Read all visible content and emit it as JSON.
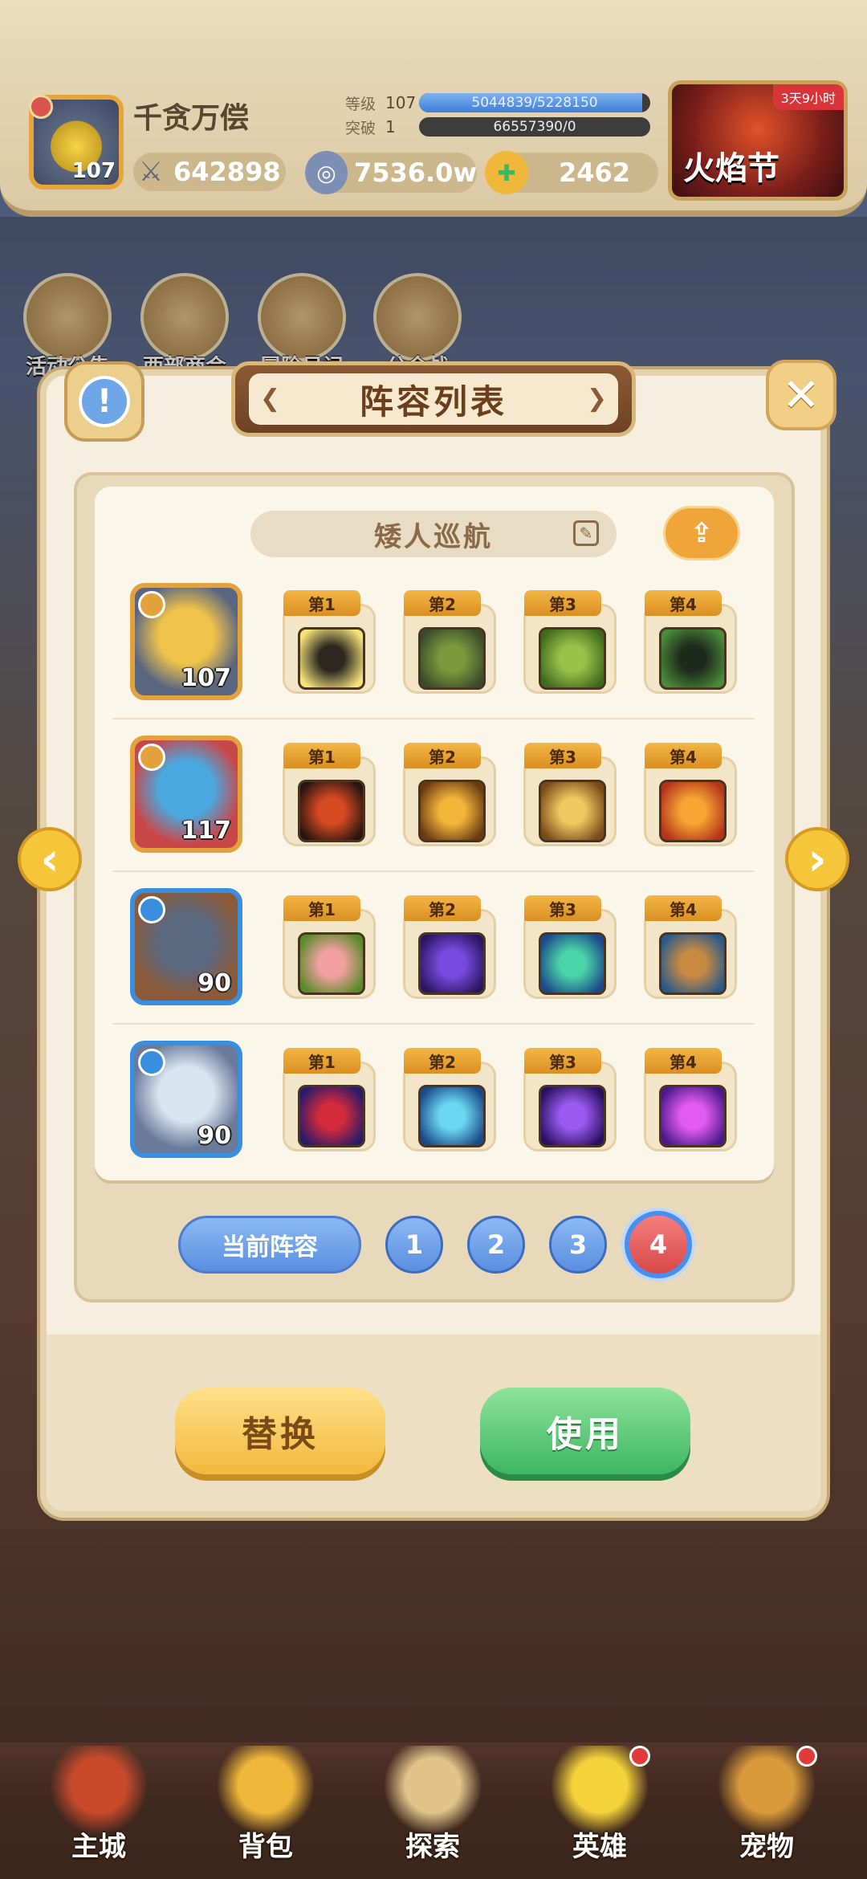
{
  "header": {
    "username": "千贪万偿",
    "avatar_level": "107",
    "power": "642898",
    "level_label": "等级",
    "level_value": "107",
    "level_progress_text": "5044839/5228150",
    "level_progress": 0.965,
    "break_label": "突破",
    "break_value": "1",
    "break_progress_text": "66557390/0",
    "break_progress": 0.0,
    "coins": "7536.0w",
    "gems": "2462",
    "event_name": "火焰节",
    "event_timer": "3天9小时"
  },
  "menu": [
    {
      "label": "活动公告",
      "icon": "notice-board-icon"
    },
    {
      "label": "西部商会",
      "icon": "merchant-icon"
    },
    {
      "label": "冒险日记",
      "icon": "diary-icon"
    },
    {
      "label": "公会战",
      "icon": "guild-war-icon"
    }
  ],
  "dialog": {
    "title": "阵容列表",
    "lineup_name": "矮人巡航",
    "current_lineup_label": "当前阵容",
    "pages": [
      "1",
      "2",
      "3",
      "4"
    ],
    "active_page": "4",
    "replace_label": "替换",
    "use_label": "使用",
    "rows": [
      {
        "hero_level": "107",
        "hero_colors": [
          "#f0c34a",
          "#5a6680"
        ],
        "frame": "#e3a23c",
        "skills": [
          {
            "tag": "第1",
            "icon": "dark-slash-skill-icon",
            "colors": [
              "#2c2820",
              "#f6e27a"
            ]
          },
          {
            "tag": "第2",
            "icon": "spear-strike-skill-icon",
            "colors": [
              "#7a9a3c",
              "#3b4a2a"
            ]
          },
          {
            "tag": "第3",
            "icon": "star-shield-skill-icon",
            "colors": [
              "#98c24a",
              "#3f6a1c"
            ]
          },
          {
            "tag": "第4",
            "icon": "dark-armor-skill-icon",
            "colors": [
              "#1e2a1c",
              "#4a8a3a"
            ]
          }
        ]
      },
      {
        "hero_level": "117",
        "hero_colors": [
          "#4aa8e0",
          "#c8484a"
        ],
        "frame": "#e3a23c",
        "skills": [
          {
            "tag": "第1",
            "icon": "fire-eye-skill-icon",
            "colors": [
              "#d84a22",
              "#2a1610"
            ]
          },
          {
            "tag": "第2",
            "icon": "golden-strike-skill-icon",
            "colors": [
              "#f3b53a",
              "#6a3a12"
            ]
          },
          {
            "tag": "第3",
            "icon": "ground-slam-skill-icon",
            "colors": [
              "#f0c860",
              "#7a4a1a"
            ]
          },
          {
            "tag": "第4",
            "icon": "fire-dragon-skill-icon",
            "colors": [
              "#f5a532",
              "#b6321a"
            ]
          }
        ]
      },
      {
        "hero_level": "90",
        "hero_colors": [
          "#5a6880",
          "#8a5a3a"
        ],
        "frame": "#3a8ee0",
        "skills": [
          {
            "tag": "第1",
            "icon": "peach-plant-skill-icon",
            "colors": [
              "#f3a0a0",
              "#5a8a2a"
            ]
          },
          {
            "tag": "第2",
            "icon": "purple-rain-skill-icon",
            "colors": [
              "#7a4ae0",
              "#2a1660"
            ]
          },
          {
            "tag": "第3",
            "icon": "green-wave-skill-icon",
            "colors": [
              "#4ad4a8",
              "#1a4a8a"
            ]
          },
          {
            "tag": "第4",
            "icon": "tree-guardian-skill-icon",
            "colors": [
              "#c88a42",
              "#2a5a8a"
            ]
          }
        ]
      },
      {
        "hero_level": "90",
        "hero_colors": [
          "#d8e4f0",
          "#6a7a9a"
        ],
        "frame": "#3a8ee0",
        "skills": [
          {
            "tag": "第1",
            "icon": "demon-mask-skill-icon",
            "colors": [
              "#d22a3a",
              "#2a1a6a"
            ]
          },
          {
            "tag": "第2",
            "icon": "ice-hammer-skill-icon",
            "colors": [
              "#6ad8f0",
              "#1a4a8a"
            ]
          },
          {
            "tag": "第3",
            "icon": "void-vortex-skill-icon",
            "colors": [
              "#9a5af0",
              "#2a1060"
            ]
          },
          {
            "tag": "第4",
            "icon": "arcane-burst-skill-icon",
            "colors": [
              "#e25af0",
              "#4a1a8a"
            ]
          }
        ]
      }
    ]
  },
  "bottom_nav": [
    {
      "label": "主城",
      "icon": "castle-icon",
      "color": "#c84a2a"
    },
    {
      "label": "背包",
      "icon": "backpack-icon",
      "color": "#f0b83a"
    },
    {
      "label": "探索",
      "icon": "map-scroll-icon",
      "color": "#e0c48a"
    },
    {
      "label": "英雄",
      "icon": "hero-icon",
      "color": "#f3d23a"
    },
    {
      "label": "宠物",
      "icon": "pet-egg-icon",
      "color": "#d89a3a"
    }
  ]
}
